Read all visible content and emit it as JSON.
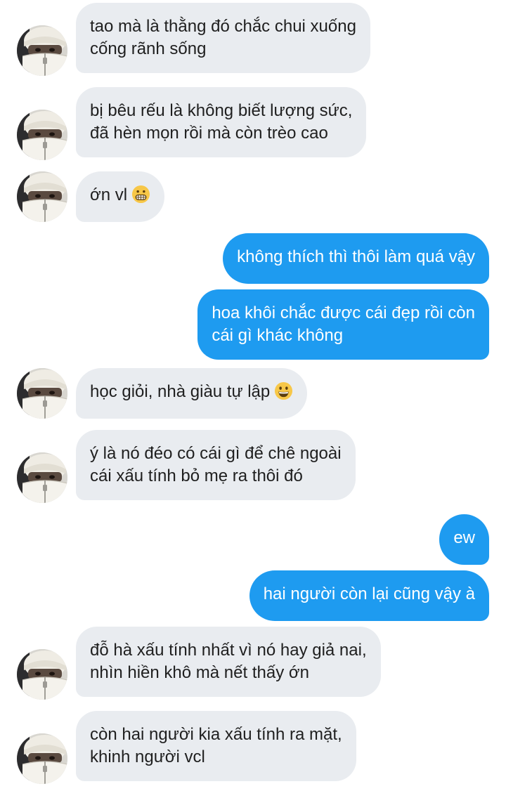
{
  "messages": [
    {
      "side": "in",
      "avatar": true,
      "lines": [
        "tao mà là thằng đó chắc chui xuống",
        "cống rãnh sống"
      ]
    },
    {
      "side": "in",
      "avatar": true,
      "lines": [
        "bị bêu rếu là không biết lượng sức,",
        "đã hèn mọn rồi mà còn trèo cao"
      ]
    },
    {
      "side": "in",
      "avatar": true,
      "lines": [
        "ớn vl"
      ],
      "emoji": "grimacing-face-emoji"
    },
    {
      "side": "out",
      "lines": [
        "không thích thì thôi làm quá vậy"
      ]
    },
    {
      "side": "out",
      "lines": [
        "hoa khôi chắc được cái đẹp rồi còn",
        "cái gì khác không"
      ]
    },
    {
      "side": "in",
      "avatar": true,
      "lines": [
        "học giỏi, nhà giàu tự lập"
      ],
      "emoji": "grinning-face-emoji"
    },
    {
      "side": "in",
      "avatar": true,
      "lines": [
        "ý là nó đéo có cái gì để chê ngoài",
        "cái xấu tính bỏ mẹ ra thôi đó"
      ]
    },
    {
      "side": "out",
      "lines": [
        "ew"
      ]
    },
    {
      "side": "out",
      "lines": [
        "hai người còn lại cũng vậy à"
      ]
    },
    {
      "side": "in",
      "avatar": true,
      "lines": [
        "đỗ hà xấu tính nhất vì nó hay giả nai,",
        "nhìn hiền khô mà nết thấy ớn"
      ]
    },
    {
      "side": "in",
      "avatar": true,
      "lines": [
        "còn hai người kia xấu tính ra mặt,",
        "khinh người vcl"
      ]
    }
  ],
  "colors": {
    "incoming_bubble": "#e9ecf0",
    "outgoing_bubble": "#1e9bf0",
    "incoming_text": "#1f1f1f",
    "outgoing_text": "#ffffff"
  }
}
